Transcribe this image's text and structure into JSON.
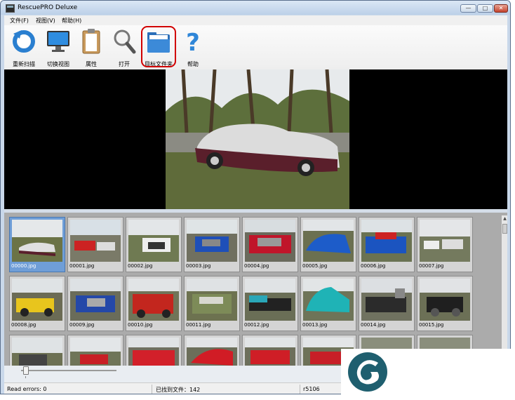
{
  "window": {
    "title": "RescuePRO Deluxe",
    "min_glyph": "—",
    "max_glyph": "□",
    "close_glyph": "✕"
  },
  "menu": [
    "文件(F)",
    "视图(V)",
    "帮助(H)"
  ],
  "toolbar": [
    {
      "label": "重新扫描",
      "icon": "rescan-icon"
    },
    {
      "label": "切换视图",
      "icon": "monitor-icon"
    },
    {
      "label": "属性",
      "icon": "clipboard-icon"
    },
    {
      "label": "打开",
      "icon": "magnifier-icon"
    },
    {
      "label": "目标文件夹",
      "icon": "folder-icon"
    },
    {
      "label": "帮助",
      "icon": "help-icon"
    }
  ],
  "thumbnails": [
    "00000.jpg",
    "00001.jpg",
    "00002.jpg",
    "00003.jpg",
    "00004.jpg",
    "00005.jpg",
    "00006.jpg",
    "00007.jpg",
    "00008.jpg",
    "00009.jpg",
    "00010.jpg",
    "00011.jpg",
    "00012.jpg",
    "00013.jpg",
    "00014.jpg",
    "00015.jpg"
  ],
  "selected_thumbnail": "00000.jpg",
  "status": {
    "errors": "Read errors: 0",
    "found": "已找到文件：142",
    "version": "r5106"
  },
  "colors": {
    "accent": "#d10000",
    "selection": "#6f9ed7",
    "logo": "#1f5f6f"
  }
}
